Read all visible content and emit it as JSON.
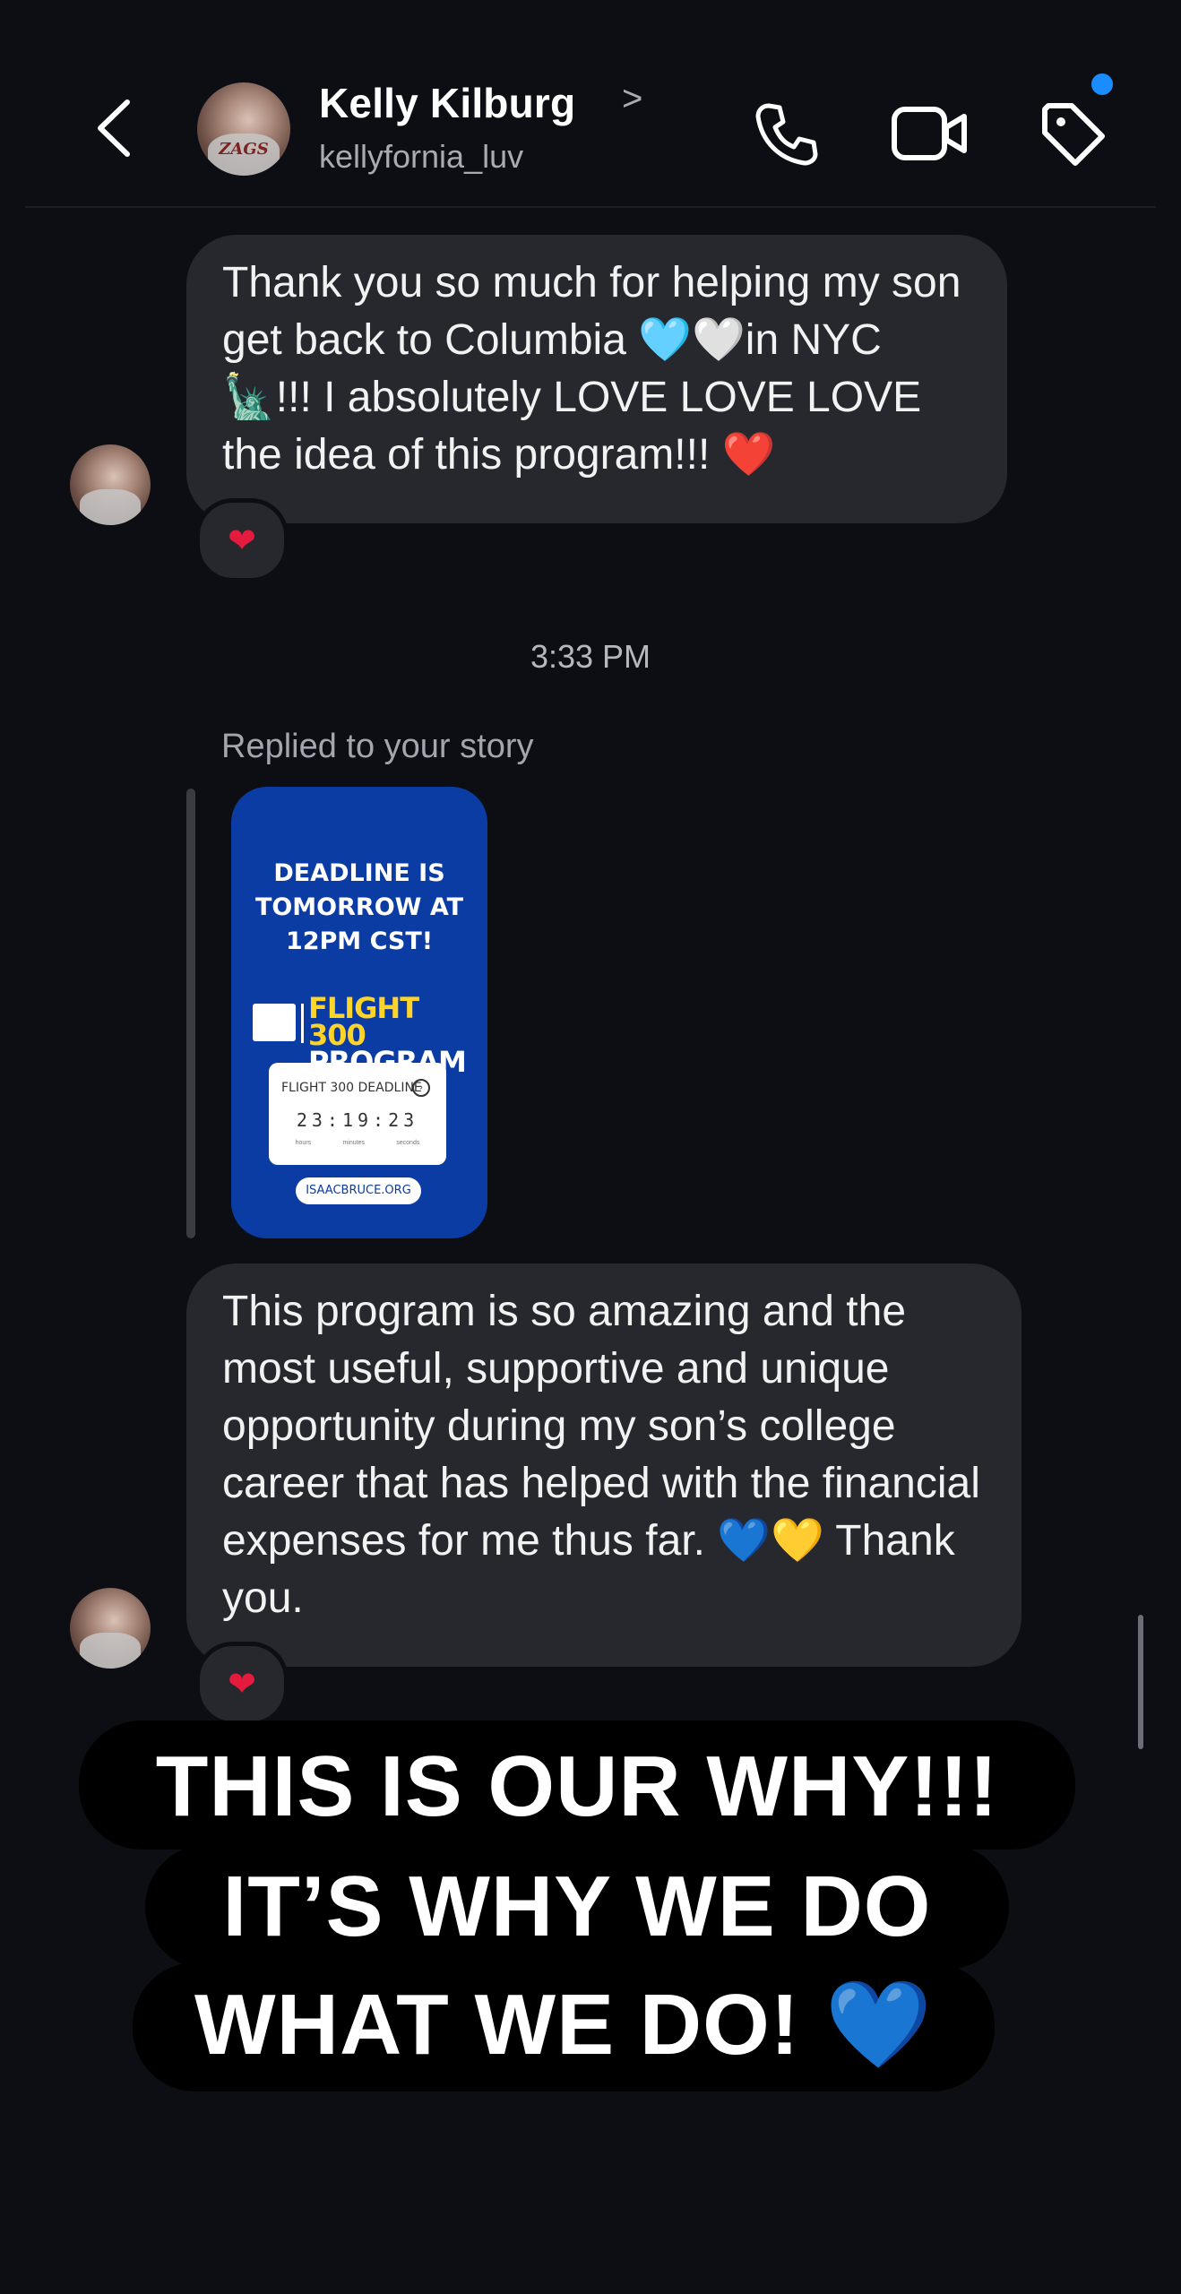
{
  "header": {
    "contact_name": "Kelly Kilburg",
    "name_chevron": ">",
    "username": "kellyfornia_luv",
    "avatar_text": "ZAGS"
  },
  "messages": [
    {
      "text": "Thank you so much for helping my son get back to Columbia 🩵🤍in NYC 🗽!!! I absolutely LOVE LOVE LOVE the idea of this program!!! ❤️",
      "reaction": "❤"
    },
    {
      "text": "This program is so amazing and the most useful, supportive  and unique opportunity during  my son’s college career that has helped with the financial expenses for me thus far.  💙💛 Thank you.",
      "reaction": "❤"
    }
  ],
  "timestamp": "3:33 PM",
  "story_reply": {
    "label": "Replied to your story",
    "headline": "DEADLINE IS TOMORROW AT 12PM CST!",
    "logo_line1": "FLIGHT 300",
    "logo_line2": "PROGRAM",
    "countdown_label": "FLIGHT 300 DEADLINE",
    "countdown_value": "23:19:23",
    "countdown_units": [
      "hours",
      "minutes",
      "seconds"
    ],
    "url": "ISAACBRUCE.ORG"
  },
  "overlay_caption": {
    "line1": "THIS IS OUR WHY!!!",
    "line2": "IT’S WHY WE DO",
    "line3": "WHAT WE DO! 💙"
  },
  "colors": {
    "background": "#0c0e13",
    "bubble": "#26282e",
    "notification_dot": "#1a8cff",
    "story_card": "#0b3ca4",
    "story_logo_yellow": "#ffd42a"
  }
}
